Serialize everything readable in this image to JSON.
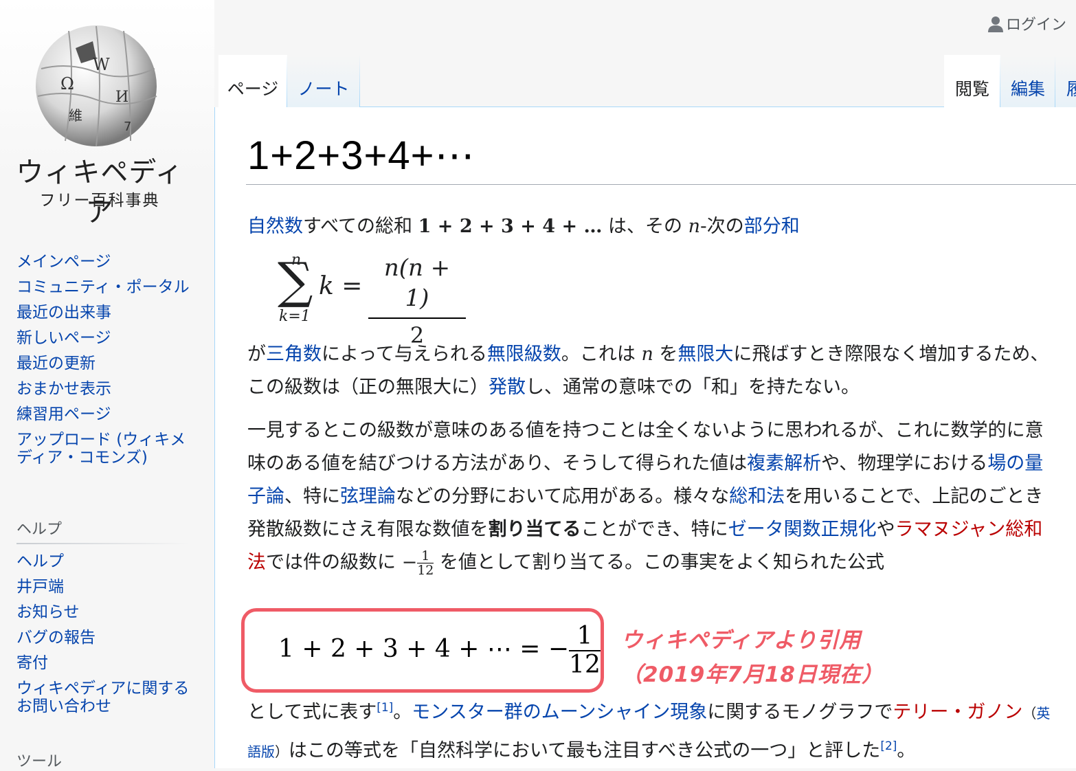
{
  "header": {
    "login": "ログイン"
  },
  "logo": {
    "name": "ウィキペディア",
    "tagline": "フリー百科事典"
  },
  "nav": {
    "main": [
      "メインページ",
      "コミュニティ・ポータル",
      "最近の出来事",
      "新しいページ",
      "最近の更新",
      "おまかせ表示",
      "練習用ページ",
      "アップロード (ウィキメディア・コモンズ)"
    ],
    "help_heading": "ヘルプ",
    "help": [
      "ヘルプ",
      "井戸端",
      "お知らせ",
      "バグの報告",
      "寄付",
      "ウィキペディアに関するお問い合わせ"
    ],
    "tools_heading": "ツール"
  },
  "tabs": {
    "page": "ページ",
    "talk": "ノート",
    "read": "閲覧",
    "edit": "編集",
    "history": "履"
  },
  "article": {
    "title": "1+2+3+4+⋯",
    "p1": {
      "link_natural": "自然数",
      "t1": "すべての総和 ",
      "series": "1 + 2 + 3 + 4 + …",
      "t2": " は、その ",
      "n": "n",
      "t3": "-次の",
      "link_partial": "部分和"
    },
    "sum_formula": {
      "top": "n",
      "bottom": "k=1",
      "k": "k =",
      "num": "n(n + 1)",
      "den": "2"
    },
    "p2": {
      "t1": "が",
      "link_tri": "三角数",
      "t2": "によって与えられる",
      "link_series": "無限級数",
      "t3": "。これは ",
      "n": "n",
      "t4": " を",
      "link_inf": "無限大",
      "t5": "に飛ばすとき際限なく増加するため、この級数は（正の無限大に）",
      "link_div": "発散",
      "t6": "し、通常の意味での「和」を持たない。"
    },
    "p3": {
      "t1": "一見するとこの級数が意味のある値を持つことは全くないように思われるが、これに数学的に意味のある値を結びつける方法があり、そうして得られた値は",
      "link_complex": "複素解析",
      "t2": "や、物理学における",
      "link_qft": "場の量子論",
      "t3": "、特に",
      "link_string": "弦理論",
      "t4": "などの分野において応用がある。様々な",
      "link_sum": "総和法",
      "t5": "を用いることで、上記のごとき発散級数にさえ有限な数値を",
      "bold": "割り当てる",
      "t6": "ことができ、特に",
      "link_zeta": "ゼータ関数正規化",
      "t7": "や",
      "link_ramanujan": "ラマヌジャン総和法",
      "t8": "では件の級数に ",
      "frac_sign": "−",
      "frac_num": "1",
      "frac_den": "12",
      "t9": " を値として割り当てる。この事実をよく知られた公式"
    },
    "big_formula": {
      "lhs": "1 + 2 + 3 + 4 + ⋯ = −",
      "num": "1",
      "den": "12"
    },
    "annotation": {
      "line1": "ウィキペディアより引用",
      "line2": "（2019年7月18日現在）"
    },
    "p4": {
      "t1": "として式に表す",
      "ref1": "[1]",
      "t2": "。",
      "link_moon": "モンスター群のムーンシャイン現象",
      "t3": "に関するモノグラフで",
      "link_terry": "テリー・ガノン",
      "link_en": "英語版",
      "t4": "はこの等式を「自然科学において最も注目すべき公式の一つ」と評した",
      "ref2": "[2]",
      "t5": "。"
    }
  }
}
